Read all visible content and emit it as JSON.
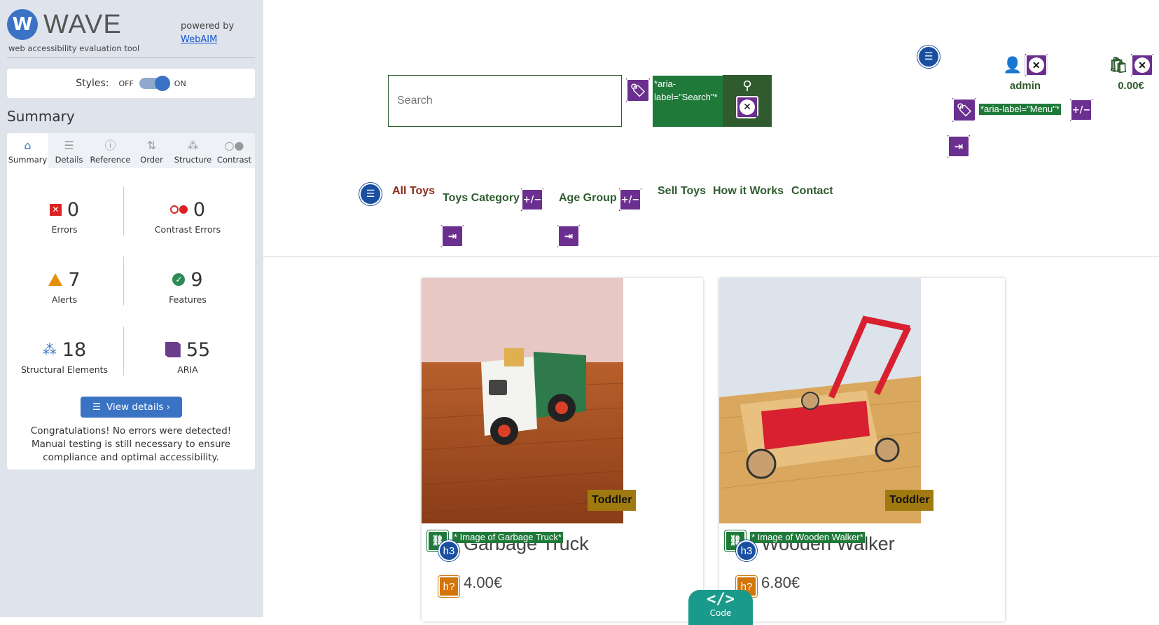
{
  "wave": {
    "logo_letter": "W",
    "name": "WAVE",
    "subtitle": "web accessibility evaluation tool",
    "powered_by": "powered by",
    "webaim_link": "WebAIM",
    "styles_label": "Styles:",
    "styles_off": "OFF",
    "styles_on": "ON",
    "summary_heading": "Summary",
    "tabs": [
      {
        "label": "Summary",
        "icon": "home-icon",
        "glyph": "⌂"
      },
      {
        "label": "Details",
        "icon": "list-icon",
        "glyph": "☰"
      },
      {
        "label": "Reference",
        "icon": "info-icon",
        "glyph": "ⓘ"
      },
      {
        "label": "Order",
        "icon": "order-icon",
        "glyph": "⇅"
      },
      {
        "label": "Structure",
        "icon": "structure-icon",
        "glyph": "⁂"
      },
      {
        "label": "Contrast",
        "icon": "contrast-icon",
        "glyph": "○●"
      }
    ],
    "stats": {
      "errors": {
        "value": "0",
        "label": "Errors"
      },
      "contrast_errors": {
        "value": "0",
        "label": "Contrast Errors"
      },
      "alerts": {
        "value": "7",
        "label": "Alerts"
      },
      "features": {
        "value": "9",
        "label": "Features"
      },
      "structural": {
        "value": "18",
        "label": "Structural Elements"
      },
      "aria": {
        "value": "55",
        "label": "ARIA"
      }
    },
    "view_details": "View details ›",
    "congrats": "Congratulations! No errors were detected! Manual testing is still necessary to ensure compliance and optimal accessibility."
  },
  "site": {
    "search_placeholder": "Search",
    "search_aria": "*aria-label=\"Search\"*",
    "menu_aria": "*aria-label=\"Menu\"*",
    "user_label": "admin",
    "cart_total": "0.00€",
    "nav": [
      "All Toys",
      "Toys Category",
      "Age Group",
      "Sell Toys",
      "How it Works",
      "Contact"
    ],
    "products": [
      {
        "title": "Garbage Truck",
        "alt": "* Image of Garbage Truck*",
        "badge": "Toddler",
        "price": "4.00€"
      },
      {
        "title": "Wooden Walker",
        "alt": "* Image of Wooden Walker*",
        "badge": "Toddler",
        "price": "6.80€"
      }
    ],
    "code_tab": "Code",
    "code_symbol": "</>"
  },
  "wave_icons": {
    "tag": "🏷",
    "plus_minus": "+/−",
    "tab": "⇥",
    "close": "✕",
    "list": "☰",
    "h3": "h3",
    "h_question": "h?",
    "link": "⛓"
  },
  "colors": {
    "wave_blue": "#3a73c4",
    "site_green": "#2f5b2f",
    "current_nav": "#8b2c1a",
    "aria_purple": "#6b2f8f",
    "badge_gold": "#a07a10"
  }
}
